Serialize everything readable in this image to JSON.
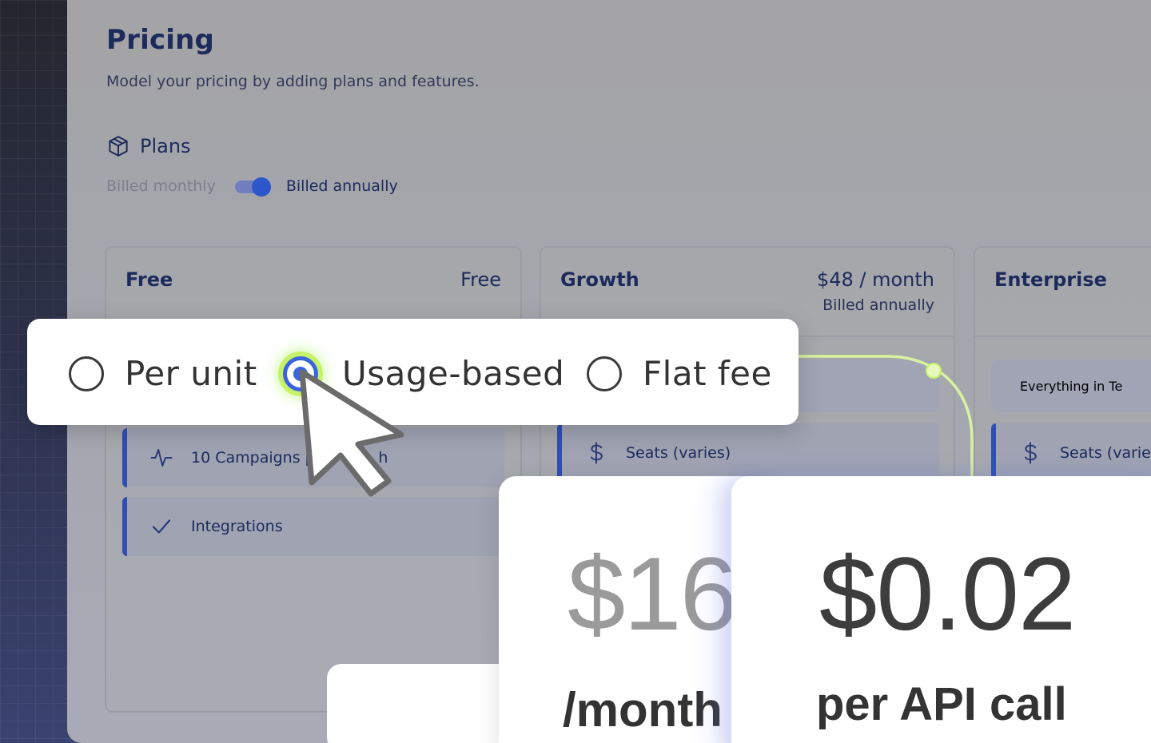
{
  "header": {
    "title": "Pricing",
    "subtitle": "Model your pricing by adding plans and features."
  },
  "plans": {
    "section_label": "Plans",
    "section_icon": "package-icon",
    "billing_monthly_label": "Billed monthly",
    "billing_annual_label": "Billed annually",
    "billing_annual_selected": true
  },
  "plan_cards": [
    {
      "name": "Free",
      "price": "Free",
      "billing": "",
      "features": [
        {
          "icon": "activity-icon",
          "label": "10 Campaigns pe",
          "label_tail": "h"
        },
        {
          "icon": "check-icon",
          "label": "Integrations"
        }
      ]
    },
    {
      "name": "Growth",
      "price": "$48 / month",
      "billing": "Billed annually",
      "features": [
        {
          "icon": "dollar-icon",
          "label": "Seats (varies)"
        }
      ]
    },
    {
      "name": "Enterprise",
      "price": "",
      "billing": "",
      "features": [
        {
          "icon": "",
          "label": "Everything in Te"
        },
        {
          "icon": "dollar-icon",
          "label": "Seats (varie"
        }
      ]
    }
  ],
  "pricing_model_selector": {
    "options": [
      "Per unit",
      "Usage-based",
      "Flat fee"
    ],
    "selected": "Usage-based"
  },
  "price_cards": [
    {
      "amount": "$16",
      "unit": "/month"
    },
    {
      "amount": "$0.02",
      "unit": "per API call"
    }
  ],
  "colors": {
    "accent": "#3a63e0",
    "title": "#1c2a5c",
    "highlight": "#c6f26a"
  }
}
